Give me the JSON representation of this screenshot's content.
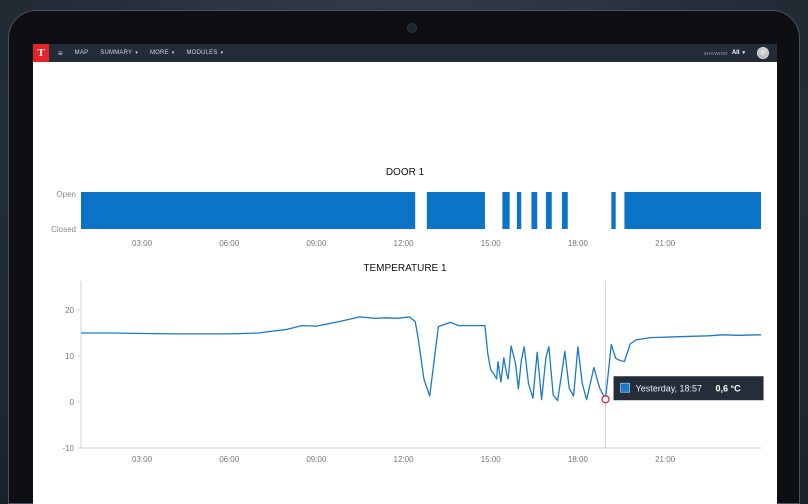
{
  "navbar": {
    "logo_text": "T",
    "items": [
      {
        "label": "MAP",
        "dropdown": false
      },
      {
        "label": "SUMMARY",
        "dropdown": true
      },
      {
        "label": "MORE",
        "dropdown": true
      },
      {
        "label": "MODULES",
        "dropdown": true
      }
    ],
    "showing_label": "SHOWING",
    "showing_value": "All"
  },
  "colors": {
    "series": "#1b7ac4",
    "bar": "#0b74c6",
    "tooltip_bg": "#252d38",
    "marker": "#d0344a"
  },
  "chart_data": [
    {
      "type": "bar",
      "title": "DOOR 1",
      "y_categories": [
        "Closed",
        "Open"
      ],
      "x_ticks": [
        "03:00",
        "06:00",
        "09:00",
        "12:00",
        "15:00",
        "18:00",
        "21:00"
      ],
      "xlim": [
        0.9,
        24.3
      ],
      "open_intervals": [
        [
          0.9,
          12.4
        ],
        [
          12.8,
          14.8
        ],
        [
          15.4,
          15.65
        ],
        [
          15.9,
          16.05
        ],
        [
          16.4,
          16.6
        ],
        [
          16.9,
          17.1
        ],
        [
          17.45,
          17.65
        ],
        [
          19.15,
          19.3
        ],
        [
          19.6,
          24.3
        ]
      ]
    },
    {
      "type": "line",
      "title": "TEMPERATURE 1",
      "x_ticks": [
        "03:00",
        "06:00",
        "09:00",
        "12:00",
        "15:00",
        "18:00",
        "21:00"
      ],
      "xlim": [
        0.9,
        24.3
      ],
      "ylim": [
        -10,
        25
      ],
      "y_ticks": [
        -10,
        0,
        10,
        20
      ],
      "series": [
        {
          "x": [
            0.9,
            2,
            4,
            6,
            7,
            8,
            8.5,
            9,
            9.4,
            9.8,
            10.5,
            11,
            11.4,
            11.8,
            12.2,
            12.4,
            12.5,
            12.7,
            12.9,
            13.2,
            13.6,
            13.9,
            14.2,
            14.5,
            14.8,
            14.9,
            15.0,
            15.1,
            15.2,
            15.25,
            15.35,
            15.45,
            15.55,
            15.6,
            15.7,
            15.85,
            15.95,
            16.05,
            16.15,
            16.3,
            16.45,
            16.6,
            16.75,
            16.9,
            17.0,
            17.15,
            17.3,
            17.45,
            17.55,
            17.7,
            17.85,
            18.0,
            18.15,
            18.3,
            18.55,
            18.75,
            18.95,
            19.15,
            19.3,
            19.45,
            19.6,
            19.8,
            20.0,
            20.5,
            21.5,
            22.5,
            23.0,
            23.5,
            24.3
          ],
          "y": [
            15.0,
            15.0,
            14.8,
            14.8,
            15.0,
            15.8,
            16.6,
            16.5,
            17.0,
            17.5,
            18.5,
            18.2,
            18.3,
            18.2,
            18.5,
            17.5,
            14.0,
            5.0,
            1.3,
            16.4,
            17.3,
            16.6,
            16.6,
            16.6,
            16.6,
            10.5,
            7.0,
            6.2,
            5.0,
            8.8,
            4.3,
            9.6,
            6.0,
            5.0,
            12.2,
            8.5,
            2.8,
            9.0,
            12.0,
            4.0,
            0.8,
            10.8,
            0.5,
            9.8,
            12.0,
            1.5,
            0.3,
            6.5,
            11.0,
            3.0,
            1.3,
            12.0,
            4.0,
            0.5,
            7.5,
            3.0,
            0.6,
            12.5,
            9.5,
            9.0,
            8.8,
            12.6,
            13.5,
            14.0,
            14.2,
            14.4,
            14.6,
            14.5,
            14.6
          ]
        }
      ],
      "crosshair_x": 18.95,
      "highlight": {
        "x": 18.95,
        "y": 0.6
      }
    }
  ],
  "tooltip": {
    "label": "Yesterday, 18:57",
    "value": "0,6 °C"
  }
}
